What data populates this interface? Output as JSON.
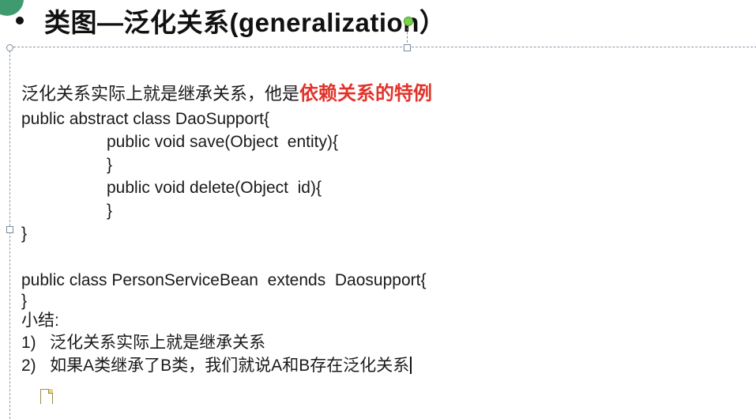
{
  "slide": {
    "title": "类图—泛化关系(generalization）",
    "intro_text": "泛化关系实际上就是继承关系，他是",
    "intro_highlight": "依赖关系的特例",
    "highlight_color": "#e2332a",
    "code_lines": [
      "public abstract class DaoSupport{",
      "public void save(Object  entity){",
      "}",
      "public void delete(Object  id){",
      "}",
      "}"
    ],
    "code_lines2": [
      "public class PersonServiceBean  extends  Daosupport{",
      "}"
    ],
    "summary_title": "小结:",
    "summary_items": [
      "1)   泛化关系实际上就是继承关系",
      "2)   如果A类继承了B类，我们就说A和B存在泛化关系"
    ]
  },
  "icons": {
    "bullet": "bullet-dot-icon",
    "rotate": "rotate-handle-icon",
    "doc": "document-icon"
  }
}
